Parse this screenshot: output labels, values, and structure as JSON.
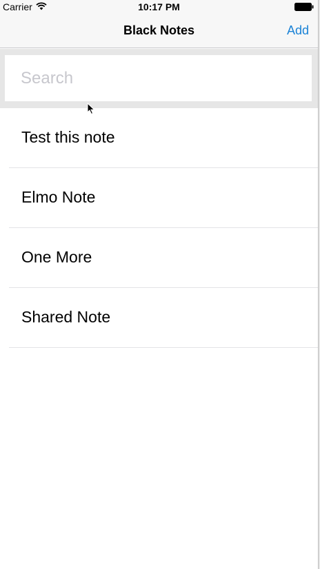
{
  "status_bar": {
    "carrier": "Carrier",
    "time": "10:17 PM"
  },
  "nav": {
    "title": "Black Notes",
    "add_label": "Add"
  },
  "search": {
    "placeholder": "Search"
  },
  "notes": [
    {
      "title": "Test this note"
    },
    {
      "title": "Elmo Note"
    },
    {
      "title": "One More"
    },
    {
      "title": "Shared Note"
    }
  ],
  "colors": {
    "accent": "#1a82d6",
    "bar_background": "#f7f7f7",
    "search_background": "#e6e6e6"
  },
  "icons": [
    "wifi-icon",
    "battery-icon",
    "pointer-cursor-icon"
  ]
}
